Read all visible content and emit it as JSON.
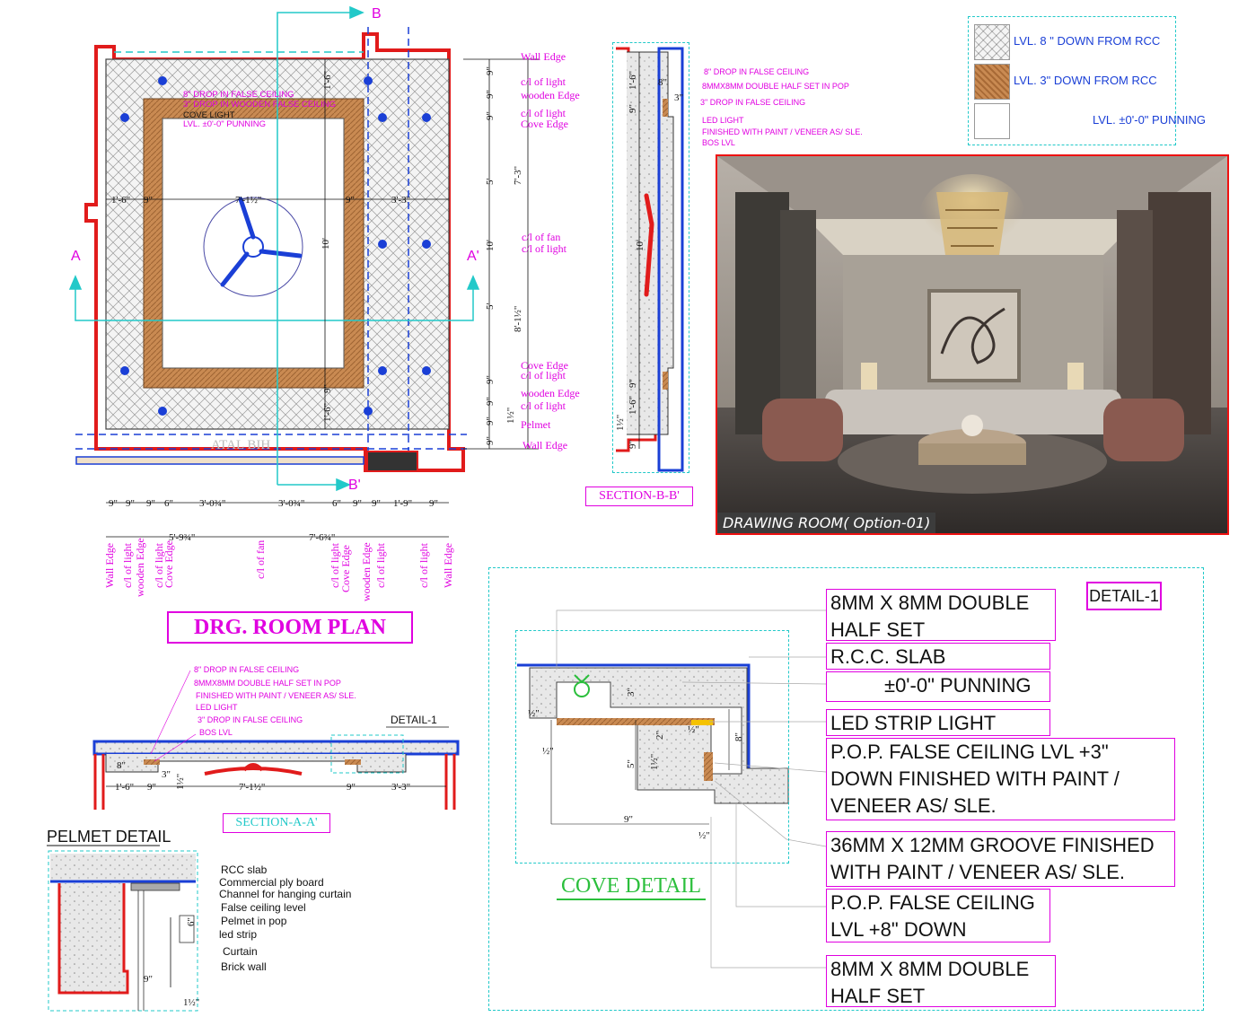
{
  "plan": {
    "title": "DRG. ROOM  PLAN",
    "section_marks": {
      "a": "A",
      "a_prime": "A'",
      "b": "B",
      "b_prime": "B'"
    },
    "center_labels": [
      "8\" DROP IN FALSE CEILING",
      "3\" DROP IN WOODEN  FALSE CEILING",
      "COVE LIGHT",
      "LVL. ±0'-0\" PUNNING"
    ],
    "right_labels": [
      "Wall Edge",
      "c/l of light",
      "wooden Edge",
      "c/l of light",
      "Cove Edge",
      "c/l of fan",
      "c/l of light",
      "Cove Edge",
      "c/l of light",
      "wooden Edge",
      "c/l of light",
      "Pelmet",
      "Wall Edge"
    ],
    "right_dims": [
      "9\"",
      "9\"",
      "9\"",
      "5'",
      "7'-3\"",
      "10'",
      "5'",
      "8'-1½\"",
      "9\"",
      "9\"",
      "9\"",
      "1½\"",
      "9\""
    ],
    "inner_dims": [
      "1'-6\"",
      "9\"",
      "7'-1½\"",
      "9\"",
      "3'-3\"",
      "10'",
      "1'-6\"",
      "1'-6\"",
      "9\""
    ],
    "bottom_dims_row1": [
      "9\"",
      "9\"",
      "9\"",
      "6\"",
      "3'-0¾\"",
      "3'-0¾\"",
      "6\"",
      "9\"",
      "9\"",
      "1'-9\"",
      "9\""
    ],
    "bottom_dims_row2": [
      "5'-9¾\"",
      "7'-6¾\""
    ],
    "bottom_labels": [
      "Wall Edge",
      "c/l of light",
      "wooden Edge",
      "c/l of light",
      "Cove Edge",
      "c/l of fan",
      "c/l of light",
      "Cove Edge",
      "wooden Edge",
      "c/l of light",
      "c/l of light",
      "Wall Edge"
    ],
    "watermark": "ATAL BIH"
  },
  "section_bb": {
    "title": "SECTION-B-B'",
    "labels": [
      "8\" DROP IN FALSE CEILING",
      "8MMX8MM DOUBLE HALF SET IN POP",
      "3\" DROP IN FALSE CEILING",
      "LED  LIGHT",
      "FINISHED  WITH PAINT / VENEER AS/ SLE.",
      "BOS LVL"
    ],
    "dims": [
      "1'-6\"",
      "9\"",
      "8\"",
      "3\"",
      "10'",
      "9\"",
      "1'-6\"",
      "9\"",
      "1½\""
    ]
  },
  "section_aa": {
    "title": "SECTION-A-A'",
    "detail_tag": "DETAIL-1",
    "labels": [
      "8\" DROP IN FALSE CEILING",
      "8MMX8MM DOUBLE HALF SET IN POP",
      "FINISHED  WITH PAINT / VENEER AS/ SLE.",
      "LED  LIGHT",
      "3\" DROP IN FALSE CEILING",
      "BOS LVL"
    ],
    "dims": [
      "1'-6\"",
      "9\"",
      "1½\"",
      "7'-1½\"",
      "9\"",
      "3'-3\"",
      "8\"",
      "3\""
    ]
  },
  "legend": [
    {
      "text": "LVL. 8 \" DOWN FROM RCC",
      "pattern": "crosshatch"
    },
    {
      "text": "LVL. 3\" DOWN FROM RCC",
      "pattern": "wood"
    },
    {
      "text": "LVL. ±0'-0\" PUNNING",
      "pattern": "plain"
    }
  ],
  "photo": {
    "caption": "DRAWING ROOM( Option-01)"
  },
  "pelmet": {
    "title": "PELMET DETAIL",
    "labels": [
      "RCC slab",
      "Commercial ply board",
      "Channel for hanging curtain",
      "False ceiling level",
      "Pelmet in pop",
      "led  strip",
      "Curtain",
      "Brick wall"
    ],
    "dims": [
      "6\"",
      "9\"",
      "1½\""
    ]
  },
  "cove": {
    "title": "COVE DETAIL",
    "tag": "DETAIL-1",
    "dims": [
      "3\"",
      "8\"",
      "5\"",
      "2\"",
      "9\"",
      "½\"",
      "1½\"",
      "½\"",
      "½\"",
      "½\""
    ],
    "callouts": [
      {
        "lines": [
          "8MM X 8MM DOUBLE",
          "HALF SET"
        ]
      },
      {
        "lines": [
          "R.C.C. SLAB"
        ]
      },
      {
        "lines": [
          "±0'-0\" PUNNING"
        ]
      },
      {
        "lines": [
          "LED STRIP LIGHT"
        ]
      },
      {
        "lines": [
          "P.O.P. FALSE CEILING LVL +3\"",
          "DOWN  FINISHED  WITH PAINT /",
          "VENEER AS/ SLE."
        ]
      },
      {
        "lines": [
          "36MM X 12MM GROOVE FINISHED",
          "WITH PAINT / VENEER AS/ SLE."
        ]
      },
      {
        "lines": [
          "P.O.P. FALSE CEILING",
          "LVL +8\" DOWN"
        ]
      },
      {
        "lines": [
          "8MM X 8MM DOUBLE",
          "HALF SET"
        ]
      }
    ]
  },
  "colors": {
    "wall_red": "#e11b1b",
    "annotation_magenta": "#e000e0",
    "light_blue": "#1a3fd6",
    "guide_cyan": "#22c9c9",
    "wood_brown": "#b87a45"
  }
}
